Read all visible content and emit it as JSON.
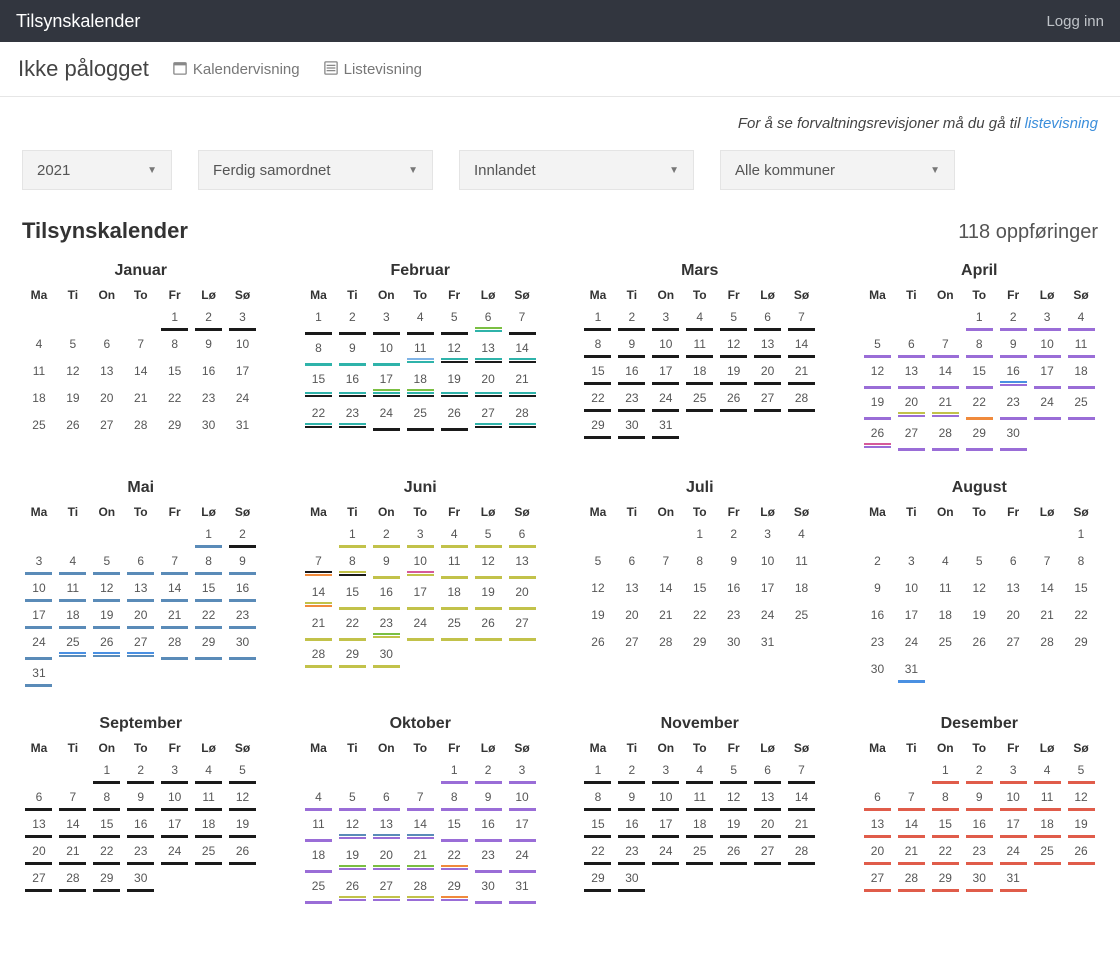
{
  "topbar": {
    "title": "Tilsynskalender",
    "login": "Logg inn"
  },
  "subheader": {
    "title": "Ikke pålogget",
    "kalender": "Kalendervisning",
    "liste": "Listevisning"
  },
  "info": {
    "text": "For å se forvaltningsrevisjoner må du gå til ",
    "link": "listevisning"
  },
  "filters": {
    "year": "2021",
    "status": "Ferdig samordnet",
    "region": "Innlandet",
    "kommune": "Alle kommuner"
  },
  "content": {
    "title": "Tilsynskalender",
    "entries": "118 oppføringer"
  },
  "weekdays": [
    "Ma",
    "Ti",
    "On",
    "To",
    "Fr",
    "Lø",
    "Sø"
  ],
  "colors": {
    "black": "#1a1a1a",
    "teal": "#2fb3aa",
    "green": "#7bbf42",
    "purple": "#9a6dd7",
    "blue": "#4a90e2",
    "steel": "#5a8bb8",
    "olive": "#c2c24a",
    "orange": "#f08a3c",
    "pink": "#d65a9a",
    "red": "#e05c4a",
    "ltblue": "#7fb3e6"
  },
  "months": [
    {
      "name": "Januar",
      "firstDow": 4,
      "days": 31,
      "marks": {
        "1": [
          "black"
        ],
        "2": [
          "black"
        ],
        "3": [
          "black"
        ]
      }
    },
    {
      "name": "Februar",
      "firstDow": 0,
      "days": 28,
      "marks": {
        "1": [
          "black"
        ],
        "2": [
          "black"
        ],
        "3": [
          "black"
        ],
        "4": [
          "black"
        ],
        "5": [
          "black"
        ],
        "6": [
          "teal",
          "green"
        ],
        "7": [
          "black"
        ],
        "8": [
          "teal"
        ],
        "9": [
          "teal"
        ],
        "10": [
          "teal"
        ],
        "11": [
          "teal",
          "ltblue"
        ],
        "12": [
          "black",
          "teal"
        ],
        "13": [
          "black",
          "teal"
        ],
        "14": [
          "black",
          "teal"
        ],
        "15": [
          "black",
          "teal"
        ],
        "16": [
          "black",
          "teal"
        ],
        "17": [
          "black",
          "teal",
          "green"
        ],
        "18": [
          "black",
          "teal",
          "green"
        ],
        "19": [
          "black",
          "teal"
        ],
        "20": [
          "black",
          "teal"
        ],
        "21": [
          "black",
          "teal"
        ],
        "22": [
          "black",
          "teal"
        ],
        "23": [
          "black",
          "teal"
        ],
        "24": [
          "black"
        ],
        "25": [
          "black"
        ],
        "26": [
          "black"
        ],
        "27": [
          "black",
          "teal"
        ],
        "28": [
          "black",
          "teal"
        ]
      }
    },
    {
      "name": "Mars",
      "firstDow": 0,
      "days": 31,
      "marks": {
        "1": [
          "black"
        ],
        "2": [
          "black"
        ],
        "3": [
          "black"
        ],
        "4": [
          "black"
        ],
        "5": [
          "black"
        ],
        "6": [
          "black"
        ],
        "7": [
          "black"
        ],
        "8": [
          "black"
        ],
        "9": [
          "black"
        ],
        "10": [
          "black"
        ],
        "11": [
          "black"
        ],
        "12": [
          "black"
        ],
        "13": [
          "black"
        ],
        "14": [
          "black"
        ],
        "15": [
          "black"
        ],
        "16": [
          "black"
        ],
        "17": [
          "black"
        ],
        "18": [
          "black"
        ],
        "19": [
          "black"
        ],
        "20": [
          "black"
        ],
        "21": [
          "black"
        ],
        "22": [
          "black"
        ],
        "23": [
          "black"
        ],
        "24": [
          "black"
        ],
        "25": [
          "black"
        ],
        "26": [
          "black"
        ],
        "27": [
          "black"
        ],
        "28": [
          "black"
        ],
        "29": [
          "black"
        ],
        "30": [
          "black"
        ],
        "31": [
          "black"
        ]
      }
    },
    {
      "name": "April",
      "firstDow": 3,
      "days": 30,
      "marks": {
        "1": [
          "purple"
        ],
        "2": [
          "purple"
        ],
        "3": [
          "purple"
        ],
        "4": [
          "purple"
        ],
        "5": [
          "purple"
        ],
        "6": [
          "purple"
        ],
        "7": [
          "purple"
        ],
        "8": [
          "purple"
        ],
        "9": [
          "purple"
        ],
        "10": [
          "purple"
        ],
        "11": [
          "purple"
        ],
        "12": [
          "purple"
        ],
        "13": [
          "purple"
        ],
        "14": [
          "purple"
        ],
        "15": [
          "purple"
        ],
        "16": [
          "purple",
          "blue"
        ],
        "17": [
          "purple"
        ],
        "18": [
          "purple"
        ],
        "19": [
          "purple"
        ],
        "20": [
          "purple",
          "olive"
        ],
        "21": [
          "purple",
          "olive"
        ],
        "22": [
          "orange"
        ],
        "23": [
          "purple"
        ],
        "24": [
          "purple"
        ],
        "25": [
          "purple"
        ],
        "26": [
          "purple",
          "pink"
        ],
        "27": [
          "purple"
        ],
        "28": [
          "purple"
        ],
        "29": [
          "purple"
        ],
        "30": [
          "purple"
        ]
      }
    },
    {
      "name": "Mai",
      "firstDow": 5,
      "days": 31,
      "marks": {
        "1": [
          "steel"
        ],
        "2": [
          "black"
        ],
        "3": [
          "steel"
        ],
        "4": [
          "steel"
        ],
        "5": [
          "steel"
        ],
        "6": [
          "steel"
        ],
        "7": [
          "steel"
        ],
        "8": [
          "steel"
        ],
        "9": [
          "steel"
        ],
        "10": [
          "steel"
        ],
        "11": [
          "steel"
        ],
        "12": [
          "steel"
        ],
        "13": [
          "steel"
        ],
        "14": [
          "steel"
        ],
        "15": [
          "steel"
        ],
        "16": [
          "steel"
        ],
        "17": [
          "steel"
        ],
        "18": [
          "steel"
        ],
        "19": [
          "steel"
        ],
        "20": [
          "steel"
        ],
        "21": [
          "steel"
        ],
        "22": [
          "steel"
        ],
        "23": [
          "steel"
        ],
        "24": [
          "steel"
        ],
        "25": [
          "steel",
          "blue"
        ],
        "26": [
          "steel",
          "blue"
        ],
        "27": [
          "steel",
          "blue"
        ],
        "28": [
          "steel"
        ],
        "29": [
          "steel"
        ],
        "30": [
          "steel"
        ],
        "31": [
          "steel"
        ]
      }
    },
    {
      "name": "Juni",
      "firstDow": 1,
      "days": 30,
      "marks": {
        "1": [
          "olive"
        ],
        "2": [
          "olive"
        ],
        "3": [
          "olive"
        ],
        "4": [
          "olive"
        ],
        "5": [
          "olive"
        ],
        "6": [
          "olive"
        ],
        "7": [
          "orange",
          "black"
        ],
        "8": [
          "black",
          "olive"
        ],
        "9": [
          "olive"
        ],
        "10": [
          "olive",
          "pink"
        ],
        "11": [
          "olive"
        ],
        "12": [
          "olive"
        ],
        "13": [
          "olive"
        ],
        "14": [
          "orange",
          "olive"
        ],
        "15": [
          "olive"
        ],
        "16": [
          "olive"
        ],
        "17": [
          "olive"
        ],
        "18": [
          "olive"
        ],
        "19": [
          "olive"
        ],
        "20": [
          "olive"
        ],
        "21": [
          "olive"
        ],
        "22": [
          "olive"
        ],
        "23": [
          "olive",
          "green"
        ],
        "24": [
          "olive"
        ],
        "25": [
          "olive"
        ],
        "26": [
          "olive"
        ],
        "27": [
          "olive"
        ],
        "28": [
          "olive"
        ],
        "29": [
          "olive"
        ],
        "30": [
          "olive"
        ]
      }
    },
    {
      "name": "Juli",
      "firstDow": 3,
      "days": 31,
      "marks": {}
    },
    {
      "name": "August",
      "firstDow": 6,
      "days": 31,
      "marks": {
        "31": [
          "blue"
        ]
      }
    },
    {
      "name": "September",
      "firstDow": 2,
      "days": 30,
      "marks": {
        "1": [
          "black"
        ],
        "2": [
          "black"
        ],
        "3": [
          "black"
        ],
        "4": [
          "black"
        ],
        "5": [
          "black"
        ],
        "6": [
          "black"
        ],
        "7": [
          "black"
        ],
        "8": [
          "black"
        ],
        "9": [
          "black"
        ],
        "10": [
          "black"
        ],
        "11": [
          "black"
        ],
        "12": [
          "black"
        ],
        "13": [
          "black"
        ],
        "14": [
          "black"
        ],
        "15": [
          "black"
        ],
        "16": [
          "black"
        ],
        "17": [
          "black"
        ],
        "18": [
          "black"
        ],
        "19": [
          "black"
        ],
        "20": [
          "black"
        ],
        "21": [
          "black"
        ],
        "22": [
          "black"
        ],
        "23": [
          "black"
        ],
        "24": [
          "black"
        ],
        "25": [
          "black"
        ],
        "26": [
          "black"
        ],
        "27": [
          "black"
        ],
        "28": [
          "black"
        ],
        "29": [
          "black"
        ],
        "30": [
          "black"
        ]
      }
    },
    {
      "name": "Oktober",
      "firstDow": 4,
      "days": 31,
      "marks": {
        "1": [
          "purple"
        ],
        "2": [
          "purple"
        ],
        "3": [
          "purple"
        ],
        "4": [
          "purple"
        ],
        "5": [
          "purple"
        ],
        "6": [
          "purple"
        ],
        "7": [
          "purple"
        ],
        "8": [
          "purple"
        ],
        "9": [
          "purple"
        ],
        "10": [
          "purple"
        ],
        "11": [
          "purple"
        ],
        "12": [
          "purple",
          "steel"
        ],
        "13": [
          "purple",
          "steel"
        ],
        "14": [
          "purple",
          "steel"
        ],
        "15": [
          "purple"
        ],
        "16": [
          "purple"
        ],
        "17": [
          "purple"
        ],
        "18": [
          "purple"
        ],
        "19": [
          "purple",
          "green"
        ],
        "20": [
          "purple",
          "green"
        ],
        "21": [
          "purple",
          "green"
        ],
        "22": [
          "purple",
          "orange"
        ],
        "23": [
          "purple"
        ],
        "24": [
          "purple"
        ],
        "25": [
          "purple"
        ],
        "26": [
          "purple",
          "olive"
        ],
        "27": [
          "purple",
          "olive"
        ],
        "28": [
          "purple",
          "olive"
        ],
        "29": [
          "purple",
          "orange"
        ],
        "30": [
          "purple"
        ],
        "31": [
          "purple"
        ]
      }
    },
    {
      "name": "November",
      "firstDow": 0,
      "days": 30,
      "marks": {
        "1": [
          "black"
        ],
        "2": [
          "black"
        ],
        "3": [
          "black"
        ],
        "4": [
          "black"
        ],
        "5": [
          "black"
        ],
        "6": [
          "black"
        ],
        "7": [
          "black"
        ],
        "8": [
          "black"
        ],
        "9": [
          "black"
        ],
        "10": [
          "black"
        ],
        "11": [
          "black"
        ],
        "12": [
          "black"
        ],
        "13": [
          "black"
        ],
        "14": [
          "black"
        ],
        "15": [
          "black"
        ],
        "16": [
          "black"
        ],
        "17": [
          "black"
        ],
        "18": [
          "black"
        ],
        "19": [
          "black"
        ],
        "20": [
          "black"
        ],
        "21": [
          "black"
        ],
        "22": [
          "black"
        ],
        "23": [
          "black"
        ],
        "24": [
          "black"
        ],
        "25": [
          "black"
        ],
        "26": [
          "black"
        ],
        "27": [
          "black"
        ],
        "28": [
          "black"
        ],
        "29": [
          "black"
        ],
        "30": [
          "black"
        ]
      }
    },
    {
      "name": "Desember",
      "firstDow": 2,
      "days": 31,
      "marks": {
        "1": [
          "red"
        ],
        "2": [
          "red"
        ],
        "3": [
          "red"
        ],
        "4": [
          "red"
        ],
        "5": [
          "red"
        ],
        "6": [
          "red"
        ],
        "7": [
          "red"
        ],
        "8": [
          "red"
        ],
        "9": [
          "red"
        ],
        "10": [
          "red"
        ],
        "11": [
          "red"
        ],
        "12": [
          "red"
        ],
        "13": [
          "red"
        ],
        "14": [
          "red"
        ],
        "15": [
          "red"
        ],
        "16": [
          "red"
        ],
        "17": [
          "red"
        ],
        "18": [
          "red"
        ],
        "19": [
          "red"
        ],
        "20": [
          "red"
        ],
        "21": [
          "red"
        ],
        "22": [
          "red"
        ],
        "23": [
          "red"
        ],
        "24": [
          "red"
        ],
        "25": [
          "red"
        ],
        "26": [
          "red"
        ],
        "27": [
          "red"
        ],
        "28": [
          "red"
        ],
        "29": [
          "red"
        ],
        "30": [
          "red"
        ],
        "31": [
          "red"
        ]
      }
    }
  ]
}
